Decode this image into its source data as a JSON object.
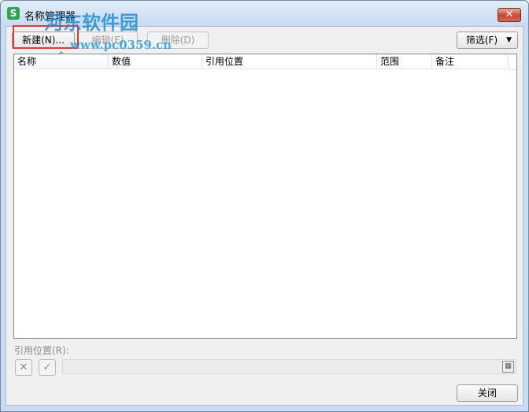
{
  "window": {
    "title": "名称管理器",
    "app_icon": "S",
    "close_glyph": "✕"
  },
  "toolbar": {
    "new_label": "新建(N)...",
    "edit_label": "编辑(E)",
    "delete_label": "删除(D)",
    "filter_label": "筛选(F)",
    "filter_arrow": "▼"
  },
  "table": {
    "columns": [
      "名称",
      "数值",
      "引用位置",
      "范围",
      "备注"
    ],
    "sort_indicator": "^",
    "rows": []
  },
  "reference": {
    "label": "引用位置(R):",
    "value": "",
    "cancel_glyph": "✕",
    "confirm_glyph": "✓",
    "picker_glyph": "▦"
  },
  "footer": {
    "close_label": "关闭"
  },
  "watermark": {
    "text": "河东软件园",
    "url": "www.pc0359.cn"
  },
  "colors": {
    "highlight": "#e53935",
    "titlebar": "#c9dcf2",
    "close": "#c8452f",
    "app_icon": "#2ea44f"
  }
}
